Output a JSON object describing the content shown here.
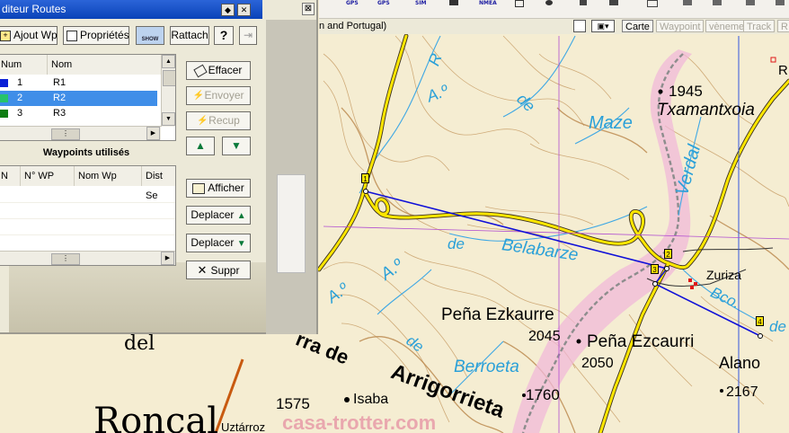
{
  "dialog": {
    "title": "diteur Routes",
    "toolbar": {
      "add_wp": "Ajout Wp",
      "properties": "Propriétés",
      "show": "SHOW",
      "attach": "Rattach",
      "help": "?"
    },
    "routes_table": {
      "headers": [
        "Num",
        "Nom"
      ],
      "rows": [
        {
          "num": "1",
          "name": "R1",
          "color": "#0a1fd6"
        },
        {
          "num": "2",
          "name": "R2",
          "color": "#27c36a",
          "selected": true
        },
        {
          "num": "3",
          "name": "R3",
          "color": "#0e7d12"
        }
      ]
    },
    "waypoints_title": "Waypoints utilisés",
    "waypoints_headers": [
      "N",
      "N° WP",
      "Nom Wp",
      "Dist Se"
    ],
    "buttons": {
      "erase": "Effacer",
      "send": "Envoyer",
      "receive": "Recup",
      "display": "Afficher",
      "move_up": "Deplacer",
      "move_down": "Deplacer",
      "delete": "Suppr"
    }
  },
  "map_toolbar": {
    "title_fragment": "n and Portugal)",
    "top_icons": [
      "GPS",
      "GPS",
      "SIM",
      "NMEA"
    ],
    "carte": "Carte",
    "waypoint": "Waypoint",
    "evenement": "vèneme",
    "track": "Track",
    "r": "R"
  },
  "map": {
    "labels": {
      "r_top": "R",
      "a_o_1": "A.º",
      "de_1": "de",
      "maze": "Maze",
      "h1945": "1945",
      "txamantxoia": "Txamantxoia",
      "verdal": "Verdal",
      "de_2": "de",
      "belabarze": "Belabarze",
      "a_o_2": "A.º",
      "a_o_3": "A.º",
      "zuriza": "Zuriza",
      "bco": "Bco.",
      "de_3": "de",
      "pena_ezkaurre": "Peña Ezkaurre",
      "h2045": "2045",
      "pena_ezcaurri": "Peña Ezcaurri",
      "h2050": "2050",
      "del": "del",
      "sierra_de": "rra de",
      "de_4": "de",
      "berroeta": "Berroeta",
      "arrigorrieta": "Arrigorrieta",
      "alano": "Alano",
      "h2167": "2167",
      "h1575": "1575",
      "isaba": "Isaba",
      "h1760": "1760",
      "roncal": "Roncal",
      "uztarroz": "Uztárroz",
      "r_right": "R",
      "watermark": "casa-trotter.com"
    },
    "waypoints": [
      "1",
      "2",
      "3",
      "4"
    ]
  }
}
